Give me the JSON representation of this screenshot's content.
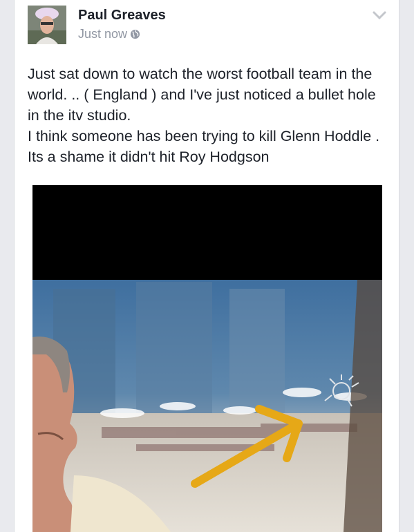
{
  "post": {
    "author": "Paul Greaves",
    "timestamp": "Just now",
    "privacy_icon": "globe-icon",
    "menu_icon": "chevron-down-icon",
    "body": {
      "line1": "Just sat down to watch the worst football team in the world. .. ( England ) and I've just noticed a bullet hole in the itv studio.",
      "line2": "I think someone has been trying to kill Glenn Hoddle . Its a shame it didn't hit Roy Hodgson"
    }
  },
  "colors": {
    "background": "#e9eaee",
    "card": "#ffffff",
    "name": "#1d2129",
    "meta": "#9197a3",
    "arrow": "#e6a817"
  }
}
